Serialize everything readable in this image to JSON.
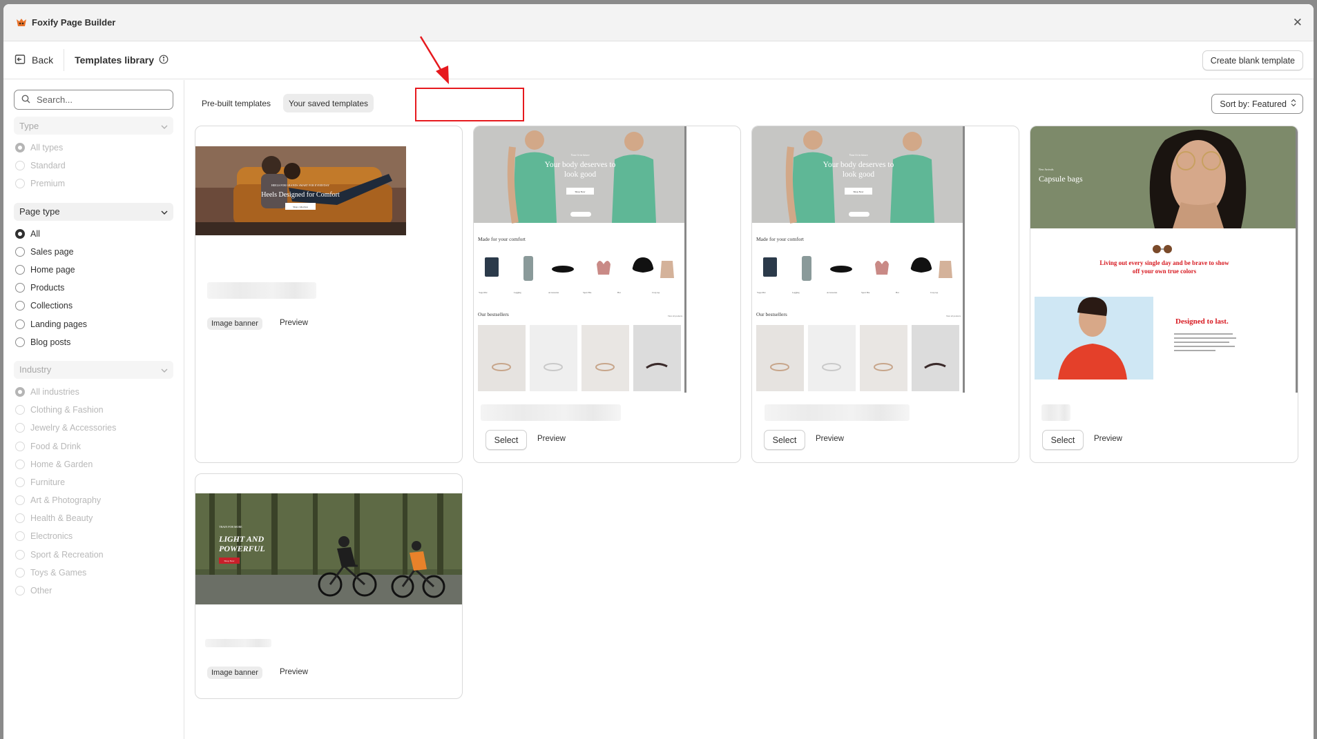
{
  "app": {
    "title": "Foxify Page Builder"
  },
  "topbar": {
    "back": "Back",
    "title": "Templates library",
    "create_button": "Create blank template"
  },
  "sidebar": {
    "search_placeholder": "Search...",
    "type": {
      "label": "Type",
      "options": [
        "All types",
        "Standard",
        "Premium"
      ],
      "selected": "All types"
    },
    "page_type": {
      "label": "Page type",
      "options": [
        "All",
        "Sales page",
        "Home page",
        "Products",
        "Collections",
        "Landing pages",
        "Blog posts"
      ],
      "selected": "All"
    },
    "industry": {
      "label": "Industry",
      "options": [
        "All industries",
        "Clothing & Fashion",
        "Jewelry & Accessories",
        "Food & Drink",
        "Home & Garden",
        "Furniture",
        "Art & Photography",
        "Health & Beauty",
        "Electronics",
        "Sport & Recreation",
        "Toys & Games",
        "Other"
      ],
      "selected": "All industries"
    }
  },
  "tabs": {
    "prebuilt": "Pre-built templates",
    "saved": "Your saved templates",
    "active": "saved"
  },
  "sort": {
    "label": "Sort by: Featured"
  },
  "cards": [
    {
      "tag": "Image banner",
      "preview": "Preview",
      "thumb_text": {
        "headline": "Heels Designed for Comfort",
        "kicker": "HEELS FOR GRANDS SMART FOR EVERYDAY",
        "button": "Shop collection"
      }
    },
    {
      "select": "Select",
      "preview": "Preview",
      "thumb_text": {
        "hero_small": "Your fit in future",
        "hero": "Your body deserves to look good",
        "hero_btn": "Shop Now",
        "section": "Made for your comfort",
        "bestsellers": "Our bestsellers",
        "view_all": "View all products",
        "categories": [
          "Yoga Mat",
          "Legging",
          "Accessories",
          "Sport Bra",
          "Hat",
          "Crop top"
        ]
      }
    },
    {
      "select": "Select",
      "preview": "Preview",
      "thumb_text": {
        "hero_small": "Your fit in future",
        "hero": "Your body deserves to look good",
        "hero_btn": "Shop Now",
        "section": "Made for your comfort",
        "bestsellers": "Our bestsellers",
        "view_all": "View all products",
        "categories": [
          "Yoga Mat",
          "Legging",
          "Accessories",
          "Sport Bra",
          "Hat",
          "Crop top"
        ]
      }
    },
    {
      "select": "Select",
      "preview": "Preview",
      "thumb_text": {
        "kicker": "New Arrivals",
        "title": "Capsule bags",
        "tagline": "Living out every single day and be brave to show off your own true colors",
        "headline2": "Designed to last."
      }
    },
    {
      "tag": "Image banner",
      "preview": "Preview",
      "thumb_text": {
        "kicker": "TRAIN FOR MORE",
        "headline_1": "LIGHT AND",
        "headline_2": "POWERFUL",
        "button": "Shop Now"
      }
    }
  ],
  "colors": {
    "highlight": "#e6191e",
    "accent_red": "#d71920"
  }
}
